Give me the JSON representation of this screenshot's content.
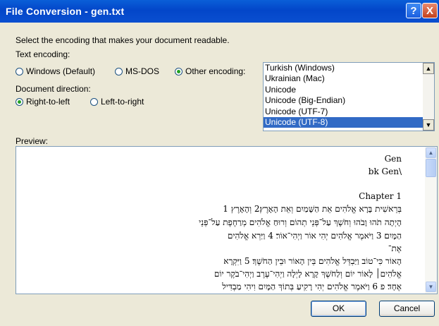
{
  "window": {
    "title": "File Conversion - gen.txt",
    "help_glyph": "?",
    "close_glyph": "X"
  },
  "instructions": "Select the encoding that makes your document readable.",
  "text_encoding": {
    "label": "Text encoding:",
    "options": [
      {
        "label": "Windows (Default)",
        "checked": false
      },
      {
        "label": "MS-DOS",
        "checked": false
      },
      {
        "label": "Other encoding:",
        "checked": true
      }
    ]
  },
  "encodings": {
    "items": [
      "Turkish (Windows)",
      "Ukrainian (Mac)",
      "Unicode",
      "Unicode (Big-Endian)",
      "Unicode (UTF-7)",
      "Unicode (UTF-8)"
    ],
    "selected": "Unicode (UTF-8)"
  },
  "document_direction": {
    "label": "Document direction:",
    "options": [
      {
        "label": "Right-to-left",
        "checked": true
      },
      {
        "label": "Left-to-right",
        "checked": false
      }
    ]
  },
  "preview": {
    "label": "Preview:",
    "lines": [
      "Gen",
      "bk Gen\\",
      "Chapter 1",
      "1 בְּרֵאשִׁית בָּרָא אֱלֹהִים אֵת הַשָּׁמַיִם וְאֵת הָאָרֶץ׃2 וְהָאָרֶץ",
      "הָיְתָה תֹהוּ וָבֹהוּ וְחֹשֶׁךְ עַל־פְּנֵי תְהוֹם וְרוּחַ אֱלֹהִים מְרַחֶפֶת עַל־פְּנֵי",
      "הַמָּיִם׃ 3 וַיֹּאמֶר אֱלֹהִים יְהִי אוֹר וַיְהִי־אוֹר׃ 4 וַיַּרְא אֱלֹהִים",
      "אֶת־",
      "הָאוֹר כִּי־טוֹב וַיַּבְדֵּל אֱלֹהִים בֵּין הָאוֹר וּבֵין הַחֹשֶׁךְ׃ 5 וַיִּקְרָא",
      "אֱלֹהִים׀ לָאוֹר יוֹם וְלַחֹשֶׁךְ קָרָא לָיְלָה וַיְהִי־עֶרֶב וַיְהִי־בֹקֶר יוֹם",
      "אֶחָד׃ פ 6 וַיֹּאמֶר אֱלֹהִים יְהִי רָקִיעַ בְּתוֹךְ הַמָּיִם וִיהִי מַבְדִּיל"
    ]
  },
  "buttons": {
    "ok": "OK",
    "cancel": "Cancel"
  },
  "colors": {
    "titlebar": "#0346c9",
    "selection": "#316ac5",
    "dialog_bg": "#ece9d8"
  }
}
